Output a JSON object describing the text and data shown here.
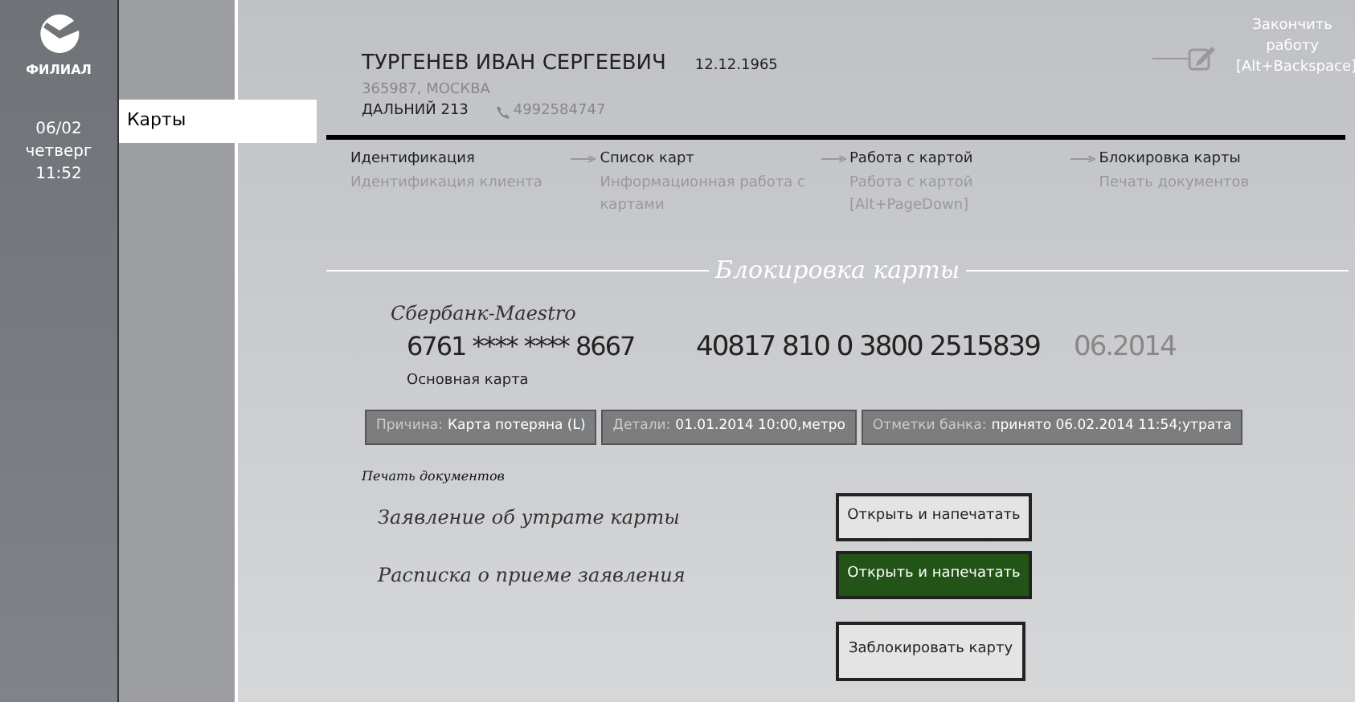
{
  "sidebar": {
    "branch": "ФИЛИАЛ",
    "date": "06/02",
    "weekday": "четверг",
    "time": "11:52"
  },
  "menu": [
    {
      "label": "Карты",
      "selected": true
    }
  ],
  "client": {
    "name": "ТУРГЕНЕВ ИВАН СЕРГЕЕВИЧ",
    "birth_date": "12.12.1965",
    "address": "365987, МОСКВА",
    "street": "ДАЛЬНИЙ 213",
    "phone": "4992584747"
  },
  "finish": {
    "label": "Закончить работу [Alt+Backspace]"
  },
  "steps": [
    {
      "title": "Идентификация",
      "subtitle": "Идентификация клиента"
    },
    {
      "title": "Список карт",
      "subtitle": "Информационная работа с картами"
    },
    {
      "title": "Работа с картой",
      "subtitle": "Работа с картой [Alt+PageDown]"
    },
    {
      "title": "Блокировка карты",
      "subtitle": "Печать документов"
    }
  ],
  "section_title": "Блокировка карты",
  "card": {
    "product": "Сбербанк-Maestro",
    "number": "6761 **** **** 8667",
    "account": "40817 810 0 3800 2515839",
    "expiry": "06.2014",
    "type": "Основная карта"
  },
  "details": [
    {
      "label": "Причина:",
      "value": "Карта потеряна (L)"
    },
    {
      "label": "Детали:",
      "value": "01.01.2014 10:00,метро"
    },
    {
      "label": "Отметки банка:",
      "value": "принято 06.02.2014 11:54;утрата"
    }
  ],
  "documents_heading": "Печать документов",
  "documents": [
    {
      "title": "Заявление об утрате карты",
      "button": "Открыть и напечатать",
      "highlighted": false
    },
    {
      "title": "Расписка о приеме заявления",
      "button": "Открыть и напечатать",
      "highlighted": true
    }
  ],
  "block_button": "Заблокировать карту"
}
